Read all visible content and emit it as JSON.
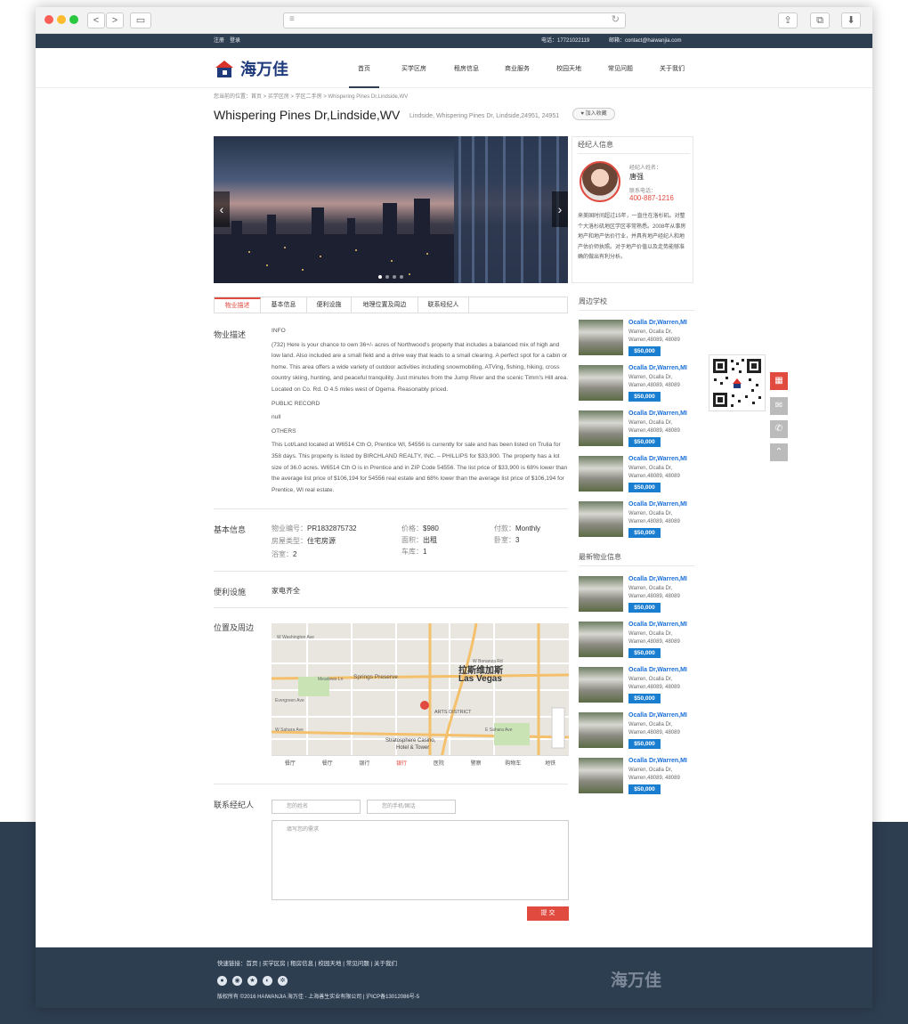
{
  "browser": {
    "back": "<",
    "forward": ">"
  },
  "topbar": {
    "register": "注册",
    "login": "登录",
    "phone": "电话：17721022119",
    "email": "邮箱：contact@haiwanjia.com"
  },
  "logo": {
    "text": "海万佳"
  },
  "nav": [
    "首页",
    "买学区房",
    "租房信息",
    "商业服务",
    "校园天地",
    "常见问题",
    "关于我们"
  ],
  "breadcrumb": "您当前的位置：首页 > 买学区房 > 学区二手房 > Whispering Pines Dr,Lindside,WV",
  "property": {
    "title": "Whispering Pines Dr,Lindside,WV",
    "address": "Lindside, Whispering Pines Dr, Lindside,24951, 24951",
    "favorite": "加入收藏"
  },
  "agent": {
    "heading": "经纪人信息",
    "name_label": "经纪人姓名：",
    "name": "唐强",
    "phone_label": "联系电话：",
    "phone": "400-887-1216",
    "bio": "来美国时间超过15年，一直住在洛杉矶。对整个大洛杉矶地区学区非常熟悉。2008年从事房地产和地产估价行业，并具有地产经纪人和地产估价师执照。对于地产价值以及走势能够准确的做出有利分析。"
  },
  "tabs": [
    "物业描述",
    "基本信息",
    "便利设施",
    "地理位置及周边",
    "联系经纪人"
  ],
  "description": {
    "label": "物业描述",
    "paragraphs": [
      "INFO",
      "(732) Here is your chance to own 36+/- acres of Northwood's property that includes a balanced mix of high and low land. Also included are a small field and a drive way that leads to a small clearing. A perfect spot for a cabin or home. This area offers a wide variety of outdoor activities including snowmobiling, ATVing, fishing, hiking, cross country skiing, hunting, and peaceful tranquility. Just minutes from the Jump River and the scenic Timm's Hill area. Located on Co. Rd. O 4.5 miles west of Ogema. Reasonably priced.",
      "PUBLIC RECORD",
      "null",
      "OTHERS",
      "This Lot/Land located at W6514 Cth O, Prentice WI, 54556 is currently for sale and has been listed on Trulia for 358 days. This property is listed by BIRCHLAND REALTY, INC. – PHILLIPS for $33,900. The property has a lot size of 36.0 acres. W6514 Cth O is in Prentice and in ZIP Code 54556. The list price of $33,900 is 68% lower than the average list price of $106,194 for 54556 real estate and 68% lower than the average list price of $106,194 for Prentice, WI real estate."
    ]
  },
  "basic": {
    "label": "基本信息",
    "items": [
      {
        "k": "物业编号：",
        "v": "PR1832875732"
      },
      {
        "k": "价格：",
        "v": "$980"
      },
      {
        "k": "付款：",
        "v": "Monthly"
      },
      {
        "k": "房屋类型：",
        "v": "住宅房源"
      },
      {
        "k": "面积：",
        "v": "出租"
      },
      {
        "k": "卧室：",
        "v": "3"
      },
      {
        "k": "浴室：",
        "v": "2"
      },
      {
        "k": "车库：",
        "v": "1"
      }
    ]
  },
  "amenities": {
    "label": "便利设施",
    "value": "家电齐全"
  },
  "location": {
    "label": "位置及周边",
    "map_labels": [
      "W Washington Ave",
      "W Bonanza Rd",
      "Springs Preserve",
      "拉斯维加斯",
      "Las Vegas",
      "ARTS DISTRICT",
      "Stratosphere Casino,",
      "Hotel & Tower",
      "Meadows Ln",
      "Evergreen Ave",
      "W Sahara Ave",
      "E Sahara Ave"
    ],
    "poi": [
      "餐厅",
      "餐厅",
      "银行",
      "银行",
      "医院",
      "警察",
      "购物车",
      "地铁"
    ]
  },
  "contact": {
    "label": "联系经纪人",
    "name_ph": "您的姓名",
    "phone_ph": "您的手机/固话",
    "msg_ph": "填写您的需求",
    "submit": "提 交"
  },
  "schools": {
    "heading": "周边学校",
    "items": [
      {
        "t": "Ocalla Dr,Warren,MI",
        "a": "Warren, Ocalla Dr, Warren,48089, 48089",
        "p": "$50,000"
      },
      {
        "t": "Ocalla Dr,Warren,MI",
        "a": "Warren, Ocalla Dr, Warren,48089, 48089",
        "p": "$50,000"
      },
      {
        "t": "Ocalla Dr,Warren,MI",
        "a": "Warren, Ocalla Dr, Warren,48089, 48089",
        "p": "$50,000"
      },
      {
        "t": "Ocalla Dr,Warren,MI",
        "a": "Warren, Ocalla Dr, Warren,48089, 48089",
        "p": "$50,000"
      },
      {
        "t": "Ocalla Dr,Warren,MI",
        "a": "Warren, Ocalla Dr, Warren,48089, 48089",
        "p": "$50,000"
      }
    ]
  },
  "latest": {
    "heading": "最新物业信息",
    "items": [
      {
        "t": "Ocalla Dr,Warren,MI",
        "a": "Warren, Ocalla Dr, Warren,48089, 48089",
        "p": "$50,000"
      },
      {
        "t": "Ocalla Dr,Warren,MI",
        "a": "Warren, Ocalla Dr, Warren,48089, 48089",
        "p": "$50,000"
      },
      {
        "t": "Ocalla Dr,Warren,MI",
        "a": "Warren, Ocalla Dr, Warren,48089, 48089",
        "p": "$50,000"
      },
      {
        "t": "Ocalla Dr,Warren,MI",
        "a": "Warren, Ocalla Dr, Warren,48089, 48089",
        "p": "$50,000"
      },
      {
        "t": "Ocalla Dr,Warren,MI",
        "a": "Warren, Ocalla Dr, Warren,48089, 48089",
        "p": "$50,000"
      }
    ]
  },
  "footer": {
    "links": "快速链接：首页 | 买学区房 | 租房信息 | 校园天地 | 常见问题 | 关于我们",
    "copyright": "版权所有 ©2016 HAIWANJIA 海万佳 - 上海善生实业有限公司 | 沪ICP备13012086号-5",
    "logo": "海万佳"
  },
  "colors": {
    "navy": "#2e3e51",
    "accent": "#e04a3f",
    "price": "#1a7ed0"
  }
}
